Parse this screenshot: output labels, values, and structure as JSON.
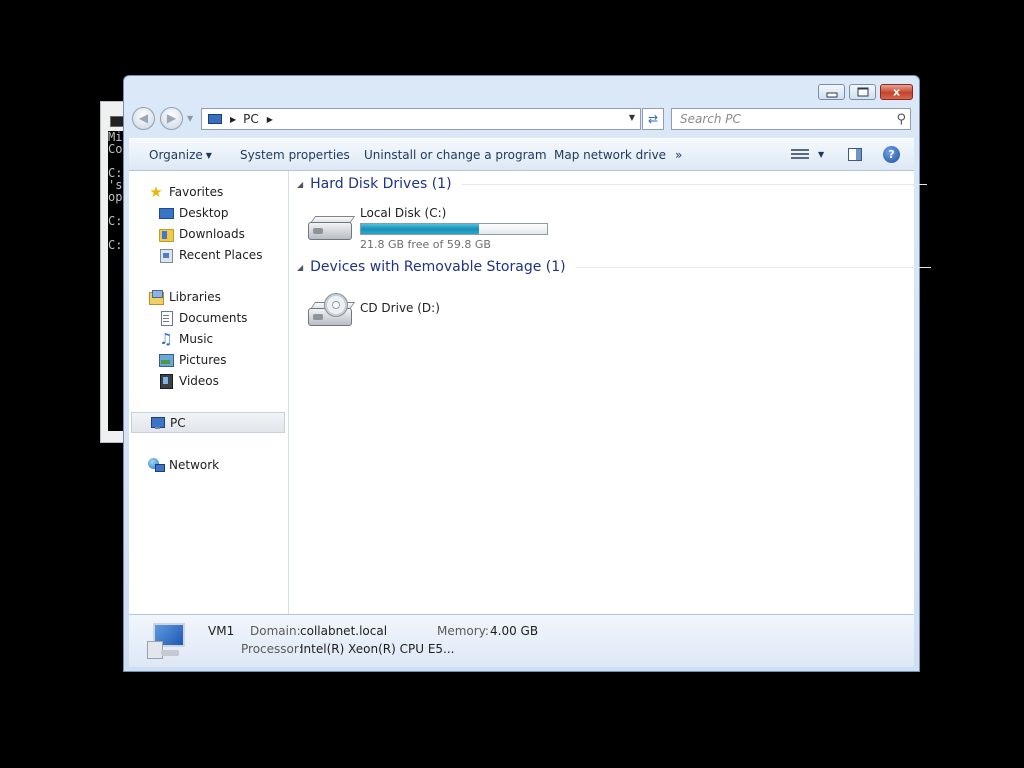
{
  "console": {
    "lines": [
      "Mi",
      "Co",
      "",
      "C:",
      "'s",
      "op",
      "",
      "C:",
      "",
      "C:"
    ]
  },
  "window": {
    "caption": {
      "minimize": "",
      "maximize": "",
      "close": "x"
    }
  },
  "address_bar": {
    "crumbs": [
      "PC"
    ],
    "search_placeholder": "Search PC"
  },
  "command_bar": {
    "items": [
      "Organize",
      "System properties",
      "Uninstall or change a program",
      "Map network drive"
    ],
    "more": "»",
    "help": "?"
  },
  "nav_pane": {
    "favorites": {
      "label": "Favorites",
      "items": [
        "Desktop",
        "Downloads",
        "Recent Places"
      ]
    },
    "libraries": {
      "label": "Libraries",
      "items": [
        "Documents",
        "Music",
        "Pictures",
        "Videos"
      ]
    },
    "pc": "PC",
    "network": "Network"
  },
  "content": {
    "groups": [
      {
        "title": "Hard Disk Drives (1)",
        "drives": [
          {
            "name": "Local Disk (C:)",
            "free_text": "21.8 GB free of 59.8 GB",
            "used_fraction": 0.635
          }
        ]
      },
      {
        "title": "Devices with Removable Storage (1)",
        "drives": [
          {
            "name": "CD Drive (D:)"
          }
        ]
      }
    ]
  },
  "details": {
    "name": "VM1",
    "domain_label": "Domain:",
    "domain": "collabnet.local",
    "memory_label": "Memory:",
    "memory": "4.00 GB",
    "processor_label": "Processor:",
    "processor": "Intel(R) Xeon(R) CPU E5..."
  }
}
